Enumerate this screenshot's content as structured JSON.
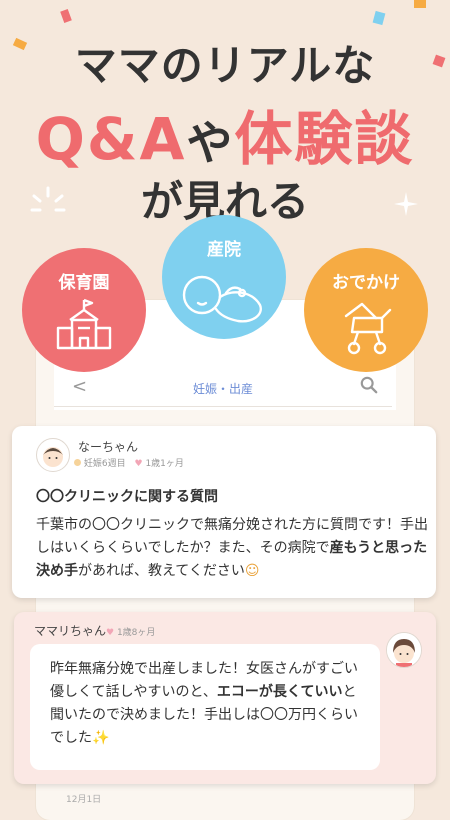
{
  "headline": {
    "line1": "ママのリアルな",
    "line2_a": "Q&A",
    "line2_b": "や",
    "line2_c": "体験談",
    "line3": "が見れる"
  },
  "categories": [
    {
      "label": "保育園",
      "icon": "school-building-icon",
      "color": "#ef7073"
    },
    {
      "label": "産院",
      "icon": "baby-icon",
      "color": "#7fd0ef"
    },
    {
      "label": "おでかけ",
      "icon": "stroller-icon",
      "color": "#f6ab43"
    }
  ],
  "navbar": {
    "back": "<",
    "title": "妊娠・出産"
  },
  "question": {
    "user_name": "なーちゃん",
    "pregnancy": "妊娠6週目",
    "child_age": "1歳1ヶ月",
    "title": "〇〇クリニックに関する質問",
    "body_1": "千葉市の〇〇クリニックで無痛分娩された方に質問です！手出しはいくらくらいでしたか？また、その病院で",
    "body_bold": "産もうと思った決め手",
    "body_2": "があれば、教えてください",
    "emoji": "☺"
  },
  "answer": {
    "user_name": "ママリちゃん",
    "child_age": "1歳8ヶ月",
    "body_1": "昨年無痛分娩で出産しました！女医さんがすごい優しくて話しやすいのと、",
    "body_bold": "エコーが長くていい",
    "body_2": "と聞いたので決めました！手出しは〇〇万円くらいでした",
    "emoji": "✨"
  },
  "footer_peek": "12月1日",
  "colors": {
    "accent_red": "#ef6b6e",
    "nav_blue": "#6d8dd6"
  }
}
